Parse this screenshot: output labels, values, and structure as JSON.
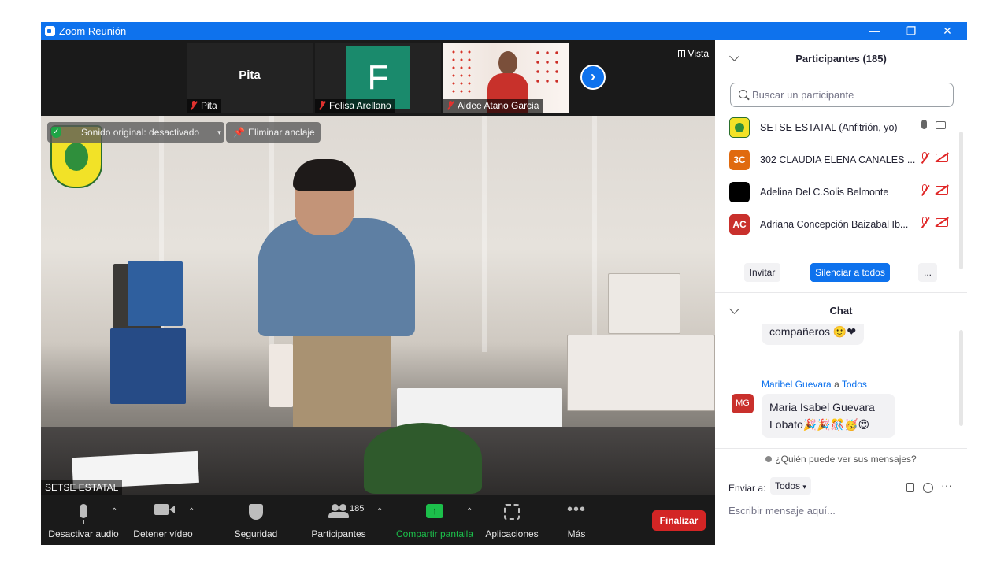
{
  "window": {
    "title": "Zoom Reunión",
    "controls": {
      "minimize": "—",
      "restore": "❐",
      "close": "✕"
    }
  },
  "video": {
    "strip": [
      {
        "name": "Pita",
        "display": "Pita",
        "muted": true,
        "avatar_letter": "",
        "avatar_color": ""
      },
      {
        "name": "Felisa Arellano",
        "display": "",
        "muted": true,
        "avatar_letter": "F",
        "avatar_color": "#1a8a6c"
      },
      {
        "name": "Aidee Atano Garcia",
        "display": "",
        "muted": true,
        "avatar_letter": "",
        "avatar_color": ""
      }
    ],
    "next_icon": "chevron-right-icon",
    "view_label": "Vista",
    "original_sound_label": "Sonido original: desactivado",
    "unpin_label": "Eliminar anclaje",
    "active_speaker_name": "SETSE ESTATAL"
  },
  "toolbar": {
    "audio_label": "Desactivar audio",
    "video_label": "Detener vídeo",
    "security_label": "Seguridad",
    "participants_label": "Participantes",
    "participants_count": "185",
    "share_label": "Compartir pantalla",
    "apps_label": "Aplicaciones",
    "more_label": "Más",
    "end_label": "Finalizar",
    "caret": "⌃",
    "share_color": "#1cc04b",
    "end_color": "#d32525"
  },
  "participants_panel": {
    "title": "Participantes (185)",
    "search_placeholder": "Buscar un participante",
    "items": [
      {
        "initials": "",
        "name": "SETSE ESTATAL (Anfitrión, yo)",
        "color": "#f2e227",
        "muted": false
      },
      {
        "initials": "3C",
        "name": "302 CLAUDIA ELENA CANALES ...",
        "color": "#e06a0e",
        "muted": true
      },
      {
        "initials": "",
        "name": "Adelina Del C.Solis Belmonte",
        "color": "#000000",
        "muted": true
      },
      {
        "initials": "AC",
        "name": "Adriana Concepción Baizabal Ib...",
        "color": "#c9302c",
        "muted": true
      }
    ],
    "invite_label": "Invitar",
    "mute_all_label": "Silenciar a todos",
    "more_label": "..."
  },
  "chat": {
    "title": "Chat",
    "prev_message_tail": "compañeros 🙂❤",
    "messages": [
      {
        "initials": "MG",
        "sender": "Maribel Guevara",
        "to_word": "a",
        "recipient": "Todos",
        "line1": "Maria Isabel Guevara",
        "line2": "Lobato🎉🎉🎊🥳😍"
      }
    ],
    "visibility_notice": "¿Quién puede ver sus mensajes?",
    "send_to_label": "Enviar a:",
    "send_to_value": "Todos",
    "compose_placeholder": "Escribir mensaje aquí...",
    "more_label": "···"
  }
}
